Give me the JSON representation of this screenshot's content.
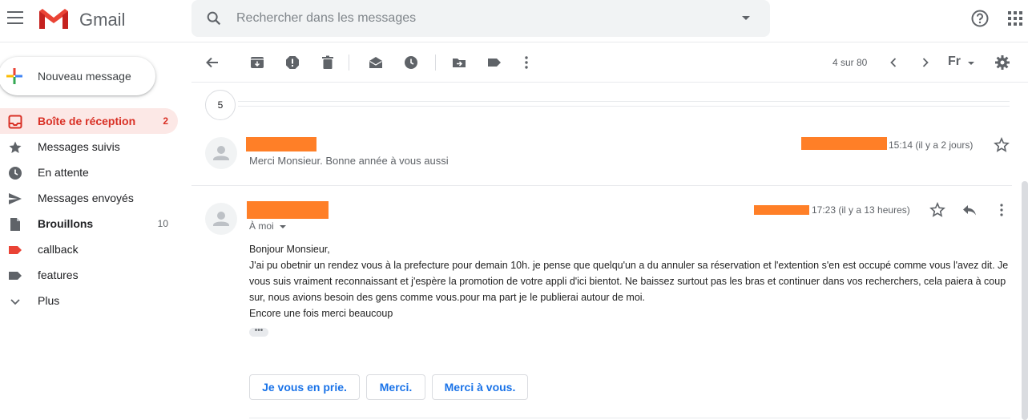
{
  "header": {
    "app_name": "Gmail",
    "search_placeholder": "Rechercher dans les messages"
  },
  "sidebar": {
    "compose_label": "Nouveau message",
    "items": [
      {
        "label": "Boîte de réception",
        "count": "2",
        "icon": "inbox-icon",
        "active": true
      },
      {
        "label": "Messages suivis",
        "count": "",
        "icon": "star-icon"
      },
      {
        "label": "En attente",
        "count": "",
        "icon": "clock-icon"
      },
      {
        "label": "Messages envoyés",
        "count": "",
        "icon": "send-icon"
      },
      {
        "label": "Brouillons",
        "count": "10",
        "icon": "draft-icon",
        "bold": true
      },
      {
        "label": "callback",
        "count": "",
        "icon": "label-icon",
        "color": "#ea4335"
      },
      {
        "label": "features",
        "count": "",
        "icon": "label-icon",
        "color": "#5f6368"
      },
      {
        "label": "Plus",
        "count": "",
        "icon": "chevron-down-icon"
      }
    ]
  },
  "toolbar": {
    "pager": "4 sur 80",
    "lang": "Fr"
  },
  "thread": {
    "collapsed_count": "5",
    "message1": {
      "snippet": "Merci Monsieur. Bonne année à vous aussi",
      "time": "15:14 (il y a 2 jours)"
    },
    "message2": {
      "to": "À moi",
      "time": "17:23 (il y a 13 heures)",
      "body": [
        "Bonjour Monsieur,",
        "J'ai pu obetnir un rendez vous à la prefecture pour demain 10h. je pense que quelqu'un a du annuler sa réservation et l'extention s'en est occupé comme vous l'avez dit. Je vous suis vraiment reconnaissant et j'espère la promotion de votre appli d'ici bientot. Ne baissez surtout pas les bras et continuer dans vos recherchers, cela paiera à coup sur, nous avions besoin des gens comme vous.pour ma part je le publierai autour de moi.",
        "Encore une fois merci beaucoup"
      ],
      "ellipsis": "•••"
    },
    "smart_replies": [
      "Je vous en prie.",
      "Merci.",
      "Merci à vous."
    ]
  },
  "colors": {
    "accent_red": "#d93025",
    "active_bg": "#fce8e6",
    "link_blue": "#1a73e8",
    "redaction": "#ff7f27"
  }
}
